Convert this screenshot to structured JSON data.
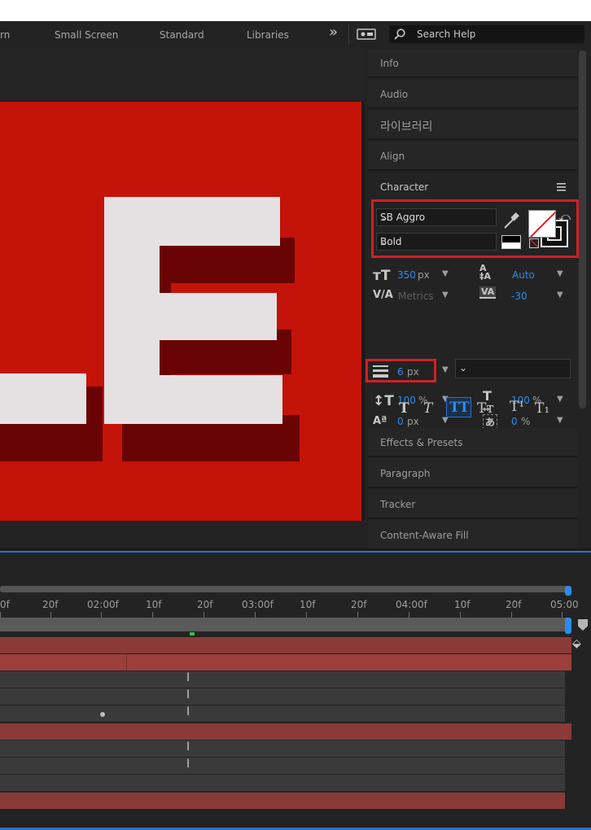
{
  "workspace": {
    "tabs": [
      "rn",
      "Small Screen",
      "Standard",
      "Libraries"
    ],
    "overflow_glyph": "»",
    "search_placeholder": "Search Help"
  },
  "comp": {
    "text": "LE",
    "bg_color": "#c41309",
    "text_color": "#e5e1e3",
    "shadow_color": "#6a0404"
  },
  "panels": {
    "collapsed_top": [
      "Info",
      "Audio",
      "라이브러리",
      "Align"
    ],
    "collapsed_bottom": [
      "Effects & Presets",
      "Paragraph",
      "Tracker",
      "Content-Aware Fill"
    ]
  },
  "character": {
    "title": "Character",
    "font_family": "SB Aggro",
    "font_style": "Bold",
    "font_size_value": "350",
    "font_size_unit": "px",
    "leading_value": "Auto",
    "kerning_value": "Metrics",
    "tracking_value": "-30",
    "stroke_width_value": "6",
    "stroke_width_unit": "px",
    "vertical_scale_value": "100",
    "vertical_scale_unit": "%",
    "horizontal_scale_value": "100",
    "horizontal_scale_unit": "%",
    "baseline_shift_value": "0",
    "baseline_shift_unit": "px",
    "tsume_value": "0",
    "tsume_unit": "%",
    "style_buttons": [
      "T",
      "T",
      "TT",
      "Tт",
      "T¹",
      "T₁"
    ]
  },
  "timeline": {
    "ruler_labels": [
      "0f",
      "20f",
      "02:00f",
      "10f",
      "20f",
      "03:00f",
      "10f",
      "20f",
      "04:00f",
      "10f",
      "20f",
      "05:00"
    ]
  },
  "colors": {
    "accent_blue": "#2d8ceb",
    "highlight_red": "#d21e28"
  }
}
